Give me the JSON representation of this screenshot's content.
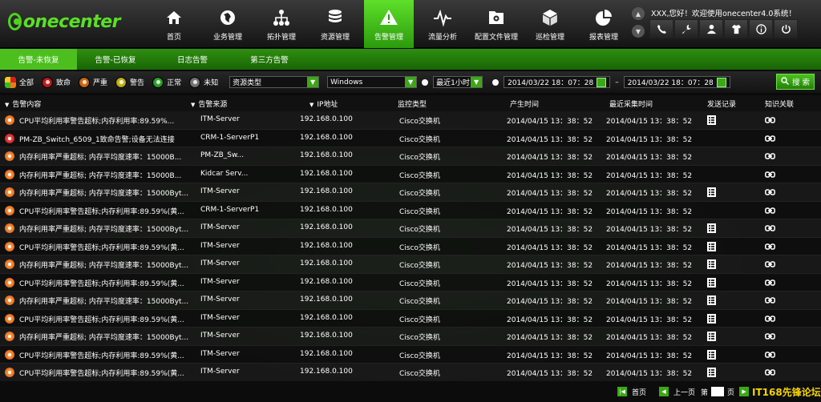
{
  "app": {
    "logo_text": "onecenter",
    "welcome": "XXX,您好！欢迎使用onecenter4.0系统！"
  },
  "nav": [
    {
      "label": "首页",
      "icon": "home-icon"
    },
    {
      "label": "业务管理",
      "icon": "globe-icon"
    },
    {
      "label": "拓扑管理",
      "icon": "topology-icon"
    },
    {
      "label": "资源管理",
      "icon": "database-icon"
    },
    {
      "label": "告警管理",
      "icon": "warning-icon",
      "active": true
    },
    {
      "label": "流量分析",
      "icon": "pulse-icon"
    },
    {
      "label": "配置文件管理",
      "icon": "config-file-icon"
    },
    {
      "label": "巡检管理",
      "icon": "cube-icon"
    },
    {
      "label": "报表管理",
      "icon": "pie-chart-icon"
    }
  ],
  "controls": [
    "phone-icon",
    "wrench-icon",
    "user-icon",
    "shirt-icon",
    "info-icon",
    "power-icon"
  ],
  "tabs": [
    "告警-未恢复",
    "告警-已恢复",
    "日志告警",
    "第三方告警"
  ],
  "filters": {
    "levels": [
      {
        "label": "全部",
        "color": "#ffffff"
      },
      {
        "label": "致命",
        "color": "#e01b1b"
      },
      {
        "label": "严重",
        "color": "#f07a12"
      },
      {
        "label": "警告",
        "color": "#e6d21a"
      },
      {
        "label": "正常",
        "color": "#2fbe2a"
      },
      {
        "label": "未知",
        "color": "#888888"
      }
    ],
    "resource_type": "资源类型",
    "os": "Windows",
    "range": "最近1小时",
    "date_from": "2014/03/22 18：07：28",
    "date_sep": "–",
    "date_to": "2014/03/22 18：07：28",
    "search_label": "搜 索"
  },
  "columns": [
    "告警内容",
    "告警来源",
    "IP地址",
    "监控类型",
    "产生时间",
    "最近采集时间",
    "发送记录",
    "知识关联"
  ],
  "rows": [
    {
      "content": "CPU平均利用率警告超标;内存利用率:89.59%...",
      "source": "ITM-Server",
      "ip": "192.168.0.100",
      "type": "Cisco交换机",
      "created": "2014/04/15 13：38：52",
      "collected": "2014/04/15 13：38：52",
      "record": true,
      "sev": "orange"
    },
    {
      "content": "PM-ZB_Switch_6509_1致命告警;设备无法连接",
      "source": "CRM-1-ServerP1",
      "ip": "192.168.0.100",
      "type": "Cisco交换机",
      "created": "2014/04/15 13：38：52",
      "collected": "2014/04/15 13：38：52",
      "record": false,
      "sev": "red"
    },
    {
      "content": "内存利用率严重超标; 内存平均度速率：15000B...",
      "source": "PM-ZB_Sw...",
      "ip": "192.168.0.100",
      "type": "Cisco交换机",
      "created": "2014/04/15 13：38：52",
      "collected": "2014/04/15 13：38：52",
      "record": false,
      "sev": "orange"
    },
    {
      "content": "内存利用率严重超标; 内存平均度速率：15000B...",
      "source": "Kidcar Serv...",
      "ip": "192.168.0.100",
      "type": "Cisco交换机",
      "created": "2014/04/15 13：38：52",
      "collected": "2014/04/15 13：38：52",
      "record": false,
      "sev": "orange"
    },
    {
      "content": "内存利用率严重超标; 内存平均度速率：15000Byt...",
      "source": "ITM-Server",
      "ip": "192.168.0.100",
      "type": "Cisco交换机",
      "created": "2014/04/15 13：38：52",
      "collected": "2014/04/15 13：38：52",
      "record": true,
      "sev": "orange"
    },
    {
      "content": "CPU平均利用率警告超标;内存利用率:89.59%(黄...",
      "source": "CRM-1-ServerP1",
      "ip": "192.168.0.100",
      "type": "Cisco交换机",
      "created": "2014/04/15 13：38：52",
      "collected": "2014/04/15 13：38：52",
      "record": false,
      "sev": "orange"
    },
    {
      "content": "内存利用率严重超标; 内存平均度速率：15000Byt...",
      "source": "ITM-Server",
      "ip": "192.168.0.100",
      "type": "Cisco交换机",
      "created": "2014/04/15 13：38：52",
      "collected": "2014/04/15 13：38：52",
      "record": true,
      "sev": "orange"
    },
    {
      "content": "CPU平均利用率警告超标;内存利用率:89.59%(黄...",
      "source": "ITM-Server",
      "ip": "192.168.0.100",
      "type": "Cisco交换机",
      "created": "2014/04/15 13：38：52",
      "collected": "2014/04/15 13：38：52",
      "record": true,
      "sev": "orange"
    },
    {
      "content": "内存利用率严重超标; 内存平均度速率：15000Byt...",
      "source": "ITM-Server",
      "ip": "192.168.0.100",
      "type": "Cisco交换机",
      "created": "2014/04/15 13：38：52",
      "collected": "2014/04/15 13：38：52",
      "record": true,
      "sev": "orange"
    },
    {
      "content": "CPU平均利用率警告超标;内存利用率:89.59%(黄...",
      "source": "ITM-Server",
      "ip": "192.168.0.100",
      "type": "Cisco交换机",
      "created": "2014/04/15 13：38：52",
      "collected": "2014/04/15 13：38：52",
      "record": true,
      "sev": "orange"
    },
    {
      "content": "内存利用率严重超标; 内存平均度速率：15000Byt...",
      "source": "ITM-Server",
      "ip": "192.168.0.100",
      "type": "Cisco交换机",
      "created": "2014/04/15 13：38：52",
      "collected": "2014/04/15 13：38：52",
      "record": true,
      "sev": "orange"
    },
    {
      "content": "CPU平均利用率警告超标;内存利用率:89.59%(黄...",
      "source": "ITM-Server",
      "ip": "192.168.0.100",
      "type": "Cisco交换机",
      "created": "2014/04/15 13：38：52",
      "collected": "2014/04/15 13：38：52",
      "record": true,
      "sev": "orange"
    },
    {
      "content": "内存利用率严重超标; 内存平均度速率：15000Byt...",
      "source": "ITM-Server",
      "ip": "192.168.0.100",
      "type": "Cisco交换机",
      "created": "2014/04/15 13：38：52",
      "collected": "2014/04/15 13：38：52",
      "record": true,
      "sev": "orange"
    },
    {
      "content": "CPU平均利用率警告超标;内存利用率:89.59%(黄...",
      "source": "ITM-Server",
      "ip": "192.168.0.100",
      "type": "Cisco交换机",
      "created": "2014/04/15 13：38：52",
      "collected": "2014/04/15 13：38：52",
      "record": true,
      "sev": "orange"
    },
    {
      "content": "CPU平均利用率警告超标;内存利用率:89.59%(黄...",
      "source": "ITM-Server",
      "ip": "192.168.0.100",
      "type": "Cisco交换机",
      "created": "2014/04/15 13：38：52",
      "collected": "2014/04/15 13：38：52",
      "record": true,
      "sev": "orange"
    }
  ],
  "pagination": {
    "first": "首页",
    "prev": "上一页",
    "page_prefix": "第",
    "page_suffix": "页"
  },
  "watermark": "IT168先锋论坛"
}
